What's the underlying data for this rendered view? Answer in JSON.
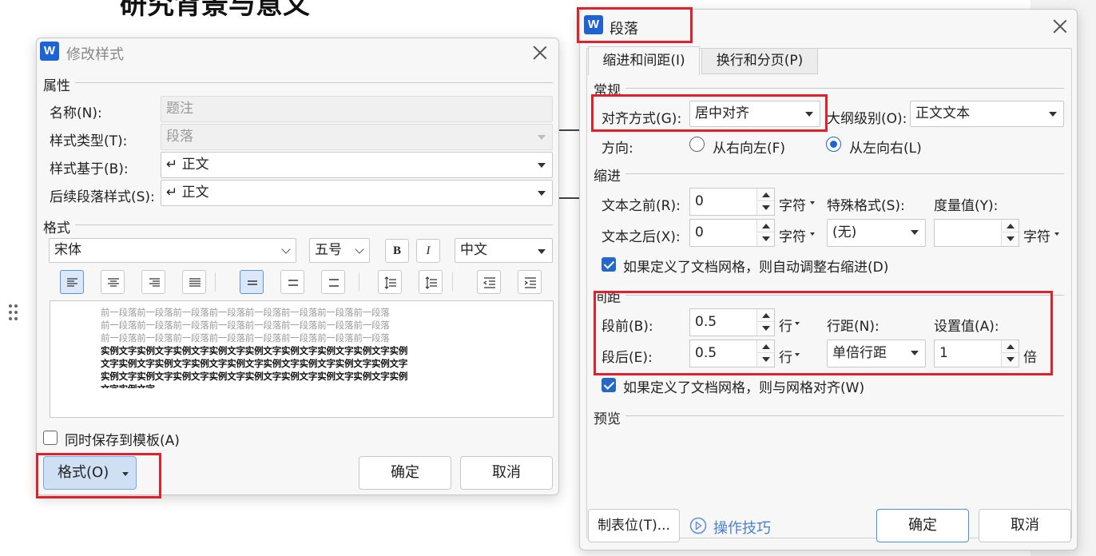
{
  "document": {
    "heading": "研究背景与意义"
  },
  "modify_style": {
    "title": "修改样式",
    "properties_title": "属性",
    "name_label": "名称(N):",
    "name_value": "题注",
    "type_label": "样式类型(T):",
    "type_value": "段落",
    "based_on_label": "样式基于(B):",
    "based_on_value": "↵ 正文",
    "following_label": "后续段落样式(S):",
    "following_value": "↵ 正文",
    "format_title": "格式",
    "font": "宋体",
    "size": "五号",
    "bold": "B",
    "italic": "I",
    "script": "中文",
    "preview_prev_lines": [
      "前一段落前一段落前一段落前一段落前一段落前一段落前一段落前一段落",
      "前一段落前一段落前一段落前一段落前一段落前一段落前一段落前一段落",
      "前一段落前一段落前一段落前一段落前一段落前一段落前一段落前一段落"
    ],
    "preview_sample_lines": [
      "实例文字实例文字实例文字实例文字实例文字实例文字实例文字实例文字实例",
      "文字实例文字实例文字实例文字实例文字实例文字实例文字实例文字实例文字",
      "实例文字实例文字实例文字实例文字实例文字实例文字实例文字实例文字实例",
      "文字实例文字"
    ],
    "save_to_template": "同时保存到模板(A)",
    "format_button": "格式(O)",
    "ok": "确定",
    "cancel": "取消"
  },
  "paragraph": {
    "title": "段落",
    "tabs": [
      "缩进和间距(I)",
      "换行和分页(P)"
    ],
    "general_title": "常规",
    "alignment_label": "对齐方式(G):",
    "alignment_value": "居中对齐",
    "outline_label": "大纲级别(O):",
    "outline_value": "正文文本",
    "direction_label": "方向:",
    "rtl_label": "从右向左(F)",
    "ltr_label": "从左向右(L)",
    "indent_title": "缩进",
    "before_text_label": "文本之前(R):",
    "before_text_value": "0",
    "after_text_label": "文本之后(X):",
    "after_text_value": "0",
    "char_unit": "字符",
    "special_label": "特殊格式(S):",
    "special_value": "(无)",
    "measure_label": "度量值(Y):",
    "measure_value": "",
    "auto_adjust_label": "如果定义了文档网格，则自动调整右缩进(D)",
    "spacing_title": "间距",
    "space_before_label": "段前(B):",
    "space_before_value": "0.5",
    "space_after_label": "段后(E):",
    "space_after_value": "0.5",
    "line_unit": "行",
    "line_spacing_label": "行距(N):",
    "line_spacing_value": "单倍行距",
    "set_value_label": "设置值(A):",
    "set_value_value": "1",
    "times_unit": "倍",
    "snap_grid_label": "如果定义了文档网格，则与网格对齐(W)",
    "preview_title": "预览",
    "tabs_button": "制表位(T)...",
    "tips_link": "操作技巧",
    "ok": "确定",
    "cancel": "取消"
  },
  "colors": {
    "accent": "#1e63d6",
    "highlight": "#e0202a"
  }
}
